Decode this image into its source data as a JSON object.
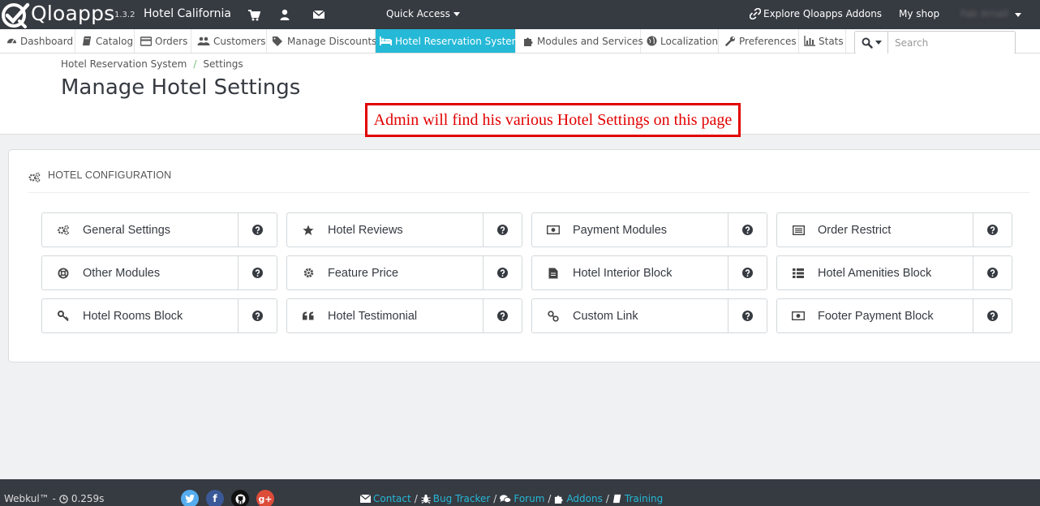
{
  "topbar": {
    "logo_text": "Qloapps",
    "version": "1.3.2",
    "shop_name": "Hotel California",
    "quick_access": "Quick Access",
    "explore_addons": "Explore Qloapps Addons",
    "my_shop": "My shop",
    "user_name": "Fab Arnall"
  },
  "nav": {
    "items": [
      {
        "label": "Dashboard",
        "icon": "dashboard-icon"
      },
      {
        "label": "Catalog",
        "icon": "book-icon"
      },
      {
        "label": "Orders",
        "icon": "credit-card-icon"
      },
      {
        "label": "Customers",
        "icon": "users-icon"
      },
      {
        "label": "Manage Discounts",
        "icon": "tags-icon"
      },
      {
        "label": "Hotel Reservation System",
        "icon": "bed-icon",
        "active": true
      },
      {
        "label": "Modules and Services",
        "icon": "puzzle-icon"
      },
      {
        "label": "Localization",
        "icon": "globe-icon"
      },
      {
        "label": "Preferences",
        "icon": "wrench-icon"
      },
      {
        "label": "Stats",
        "icon": "bar-chart-icon"
      }
    ],
    "search_placeholder": "Search"
  },
  "header": {
    "breadcrumb": [
      "Hotel Reservation System",
      "Settings"
    ],
    "breadcrumb_sep": "/",
    "title": "Manage Hotel Settings"
  },
  "annotation": "Admin will find his various Hotel Settings on this page",
  "panel": {
    "heading": "Hotel Configuration",
    "tiles": [
      {
        "label": "General Settings",
        "icon": "cogs-icon"
      },
      {
        "label": "Hotel Reviews",
        "icon": "star-icon"
      },
      {
        "label": "Payment Modules",
        "icon": "money-icon"
      },
      {
        "label": "Order Restrict",
        "icon": "list-alt-icon"
      },
      {
        "label": "Other Modules",
        "icon": "life-ring-icon"
      },
      {
        "label": "Feature Price",
        "icon": "gear-icon"
      },
      {
        "label": "Hotel Interior Block",
        "icon": "file-icon"
      },
      {
        "label": "Hotel Amenities Block",
        "icon": "th-list-icon"
      },
      {
        "label": "Hotel Rooms Block",
        "icon": "key-icon"
      },
      {
        "label": "Hotel Testimonial",
        "icon": "quote-icon"
      },
      {
        "label": "Custom Link",
        "icon": "link-icon"
      },
      {
        "label": "Footer Payment Block",
        "icon": "money-icon"
      }
    ]
  },
  "footer": {
    "brand": "Webkul™ -",
    "load_time": "0.259s",
    "links_sep": "/",
    "links": [
      "Contact",
      "Bug Tracker",
      "Forum",
      "Addons",
      "Training"
    ]
  },
  "colors": {
    "topbar": "#363a41",
    "accent": "#25b9d7",
    "annotation": "#e20000"
  }
}
